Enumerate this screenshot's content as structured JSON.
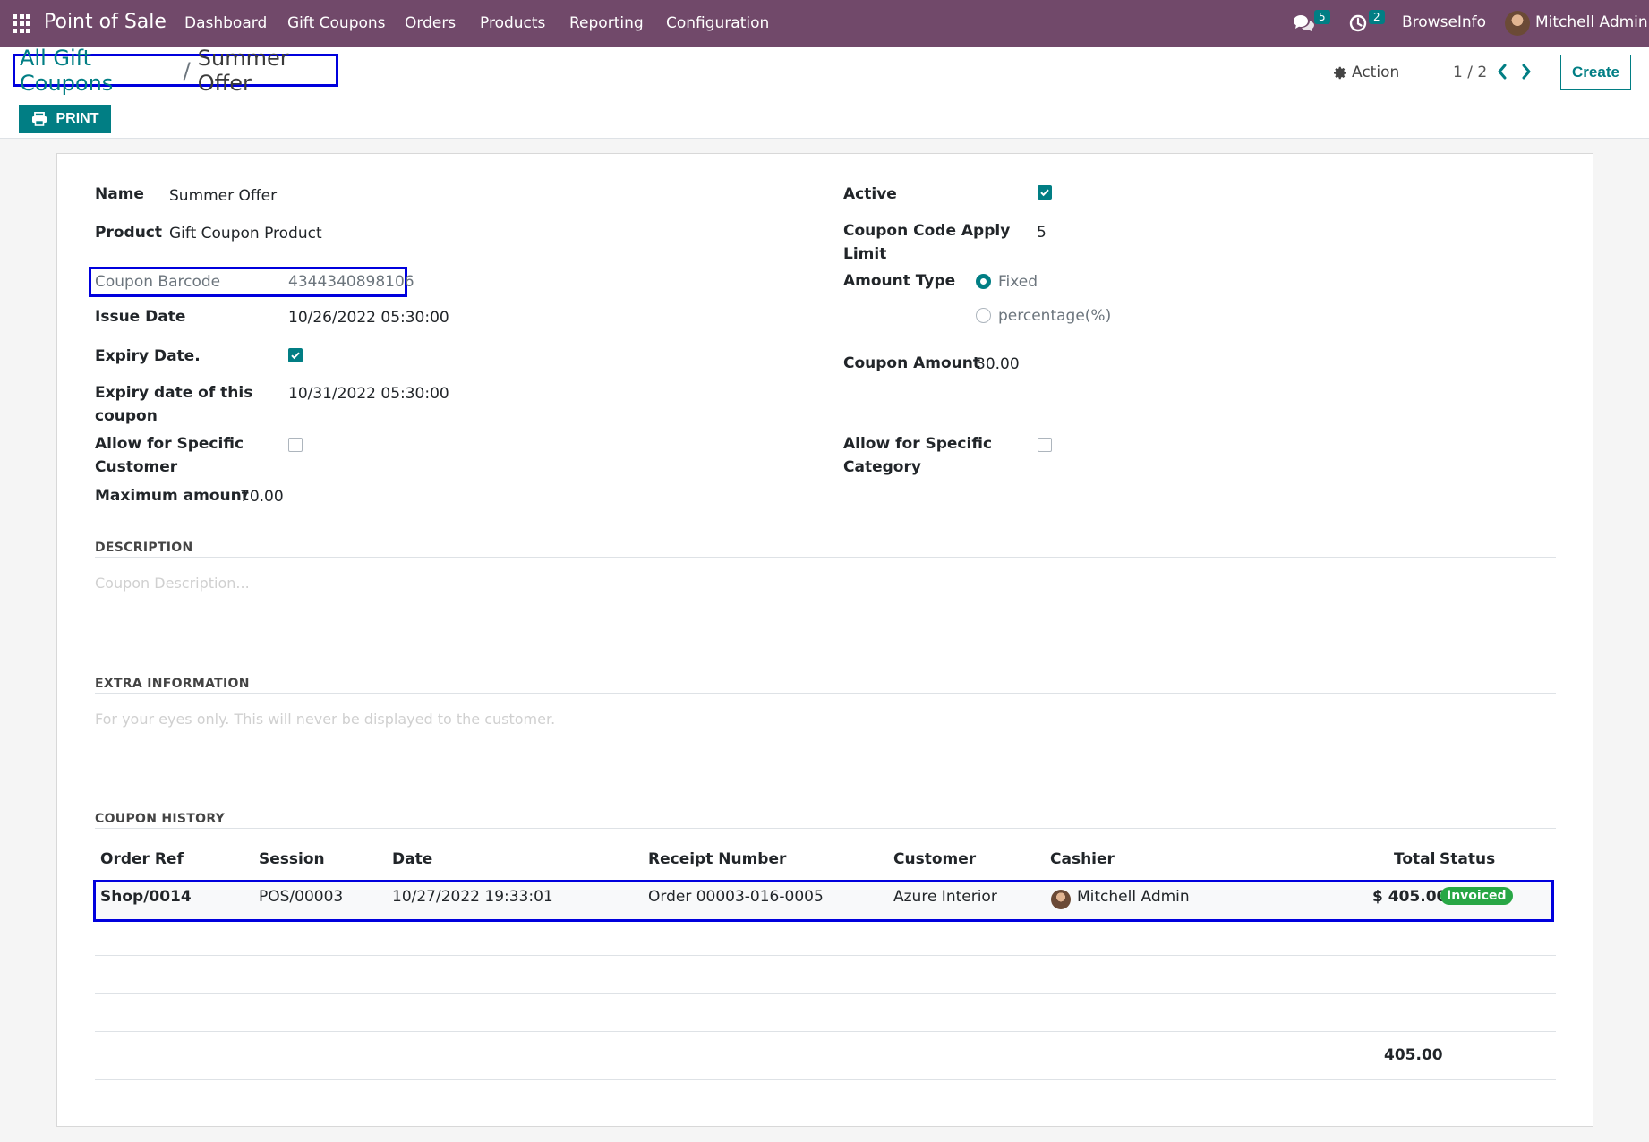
{
  "navbar": {
    "brand": "Point of Sale",
    "menu": [
      "Dashboard",
      "Gift Coupons",
      "Orders",
      "Products",
      "Reporting",
      "Configuration"
    ],
    "messages_count": "5",
    "activities_count": "2",
    "company": "BrowseInfo",
    "user": "Mitchell Admin"
  },
  "control": {
    "breadcrumb_parent": "All Gift Coupons",
    "breadcrumb_sep": "/",
    "breadcrumb_current": "Summer Offer",
    "action_label": "Action",
    "pager": "1 / 2",
    "create_label": "Create",
    "print_label": "PRINT"
  },
  "form": {
    "name_label": "Name",
    "name_value": "Summer Offer",
    "product_label": "Product",
    "product_value": "Gift Coupon Product",
    "barcode_label": "Coupon Barcode",
    "barcode_value": "4344340898106",
    "issue_date_label": "Issue Date",
    "issue_date_value": "10/26/2022 05:30:00",
    "expiry_date_label": "Expiry Date.",
    "expiry_date_checked": true,
    "expiry_coupon_label_1": "Expiry date of this",
    "expiry_coupon_label_2": "coupon",
    "expiry_coupon_value": "10/31/2022 05:30:00",
    "allow_customer_label_1": "Allow for Specific",
    "allow_customer_label_2": "Customer",
    "allow_customer_checked": false,
    "max_amount_label": "Maximum amount",
    "max_amount_value": "70.00",
    "active_label": "Active",
    "active_checked": true,
    "apply_limit_label_1": "Coupon Code Apply",
    "apply_limit_label_2": "Limit",
    "apply_limit_value": "5",
    "amount_type_label": "Amount Type",
    "amount_type_options": [
      "Fixed",
      "percentage(%)"
    ],
    "amount_type_selected": "Fixed",
    "coupon_amount_label": "Coupon Amount",
    "coupon_amount_value": "30.00",
    "allow_category_label_1": "Allow for Specific",
    "allow_category_label_2": "Category",
    "allow_category_checked": false
  },
  "description": {
    "title": "DESCRIPTION",
    "placeholder": "Coupon Description..."
  },
  "extra": {
    "title": "EXTRA INFORMATION",
    "placeholder": "For your eyes only. This will never be displayed to the customer."
  },
  "history": {
    "title": "COUPON HISTORY",
    "columns": [
      "Order Ref",
      "Session",
      "Date",
      "Receipt Number",
      "Customer",
      "Cashier",
      "Total",
      "Status"
    ],
    "rows": [
      {
        "order_ref": "Shop/0014",
        "session": "POS/00003",
        "date": "10/27/2022 19:33:01",
        "receipt": "Order 00003-016-0005",
        "customer": "Azure Interior",
        "cashier": "Mitchell Admin",
        "total": "$ 405.00",
        "status": "Invoiced"
      }
    ],
    "grand_total": "405.00"
  },
  "colors": {
    "navbar": "#71496a",
    "primary": "#017e84",
    "highlight_box": "#0000dd",
    "status_invoiced": "#28a745"
  }
}
